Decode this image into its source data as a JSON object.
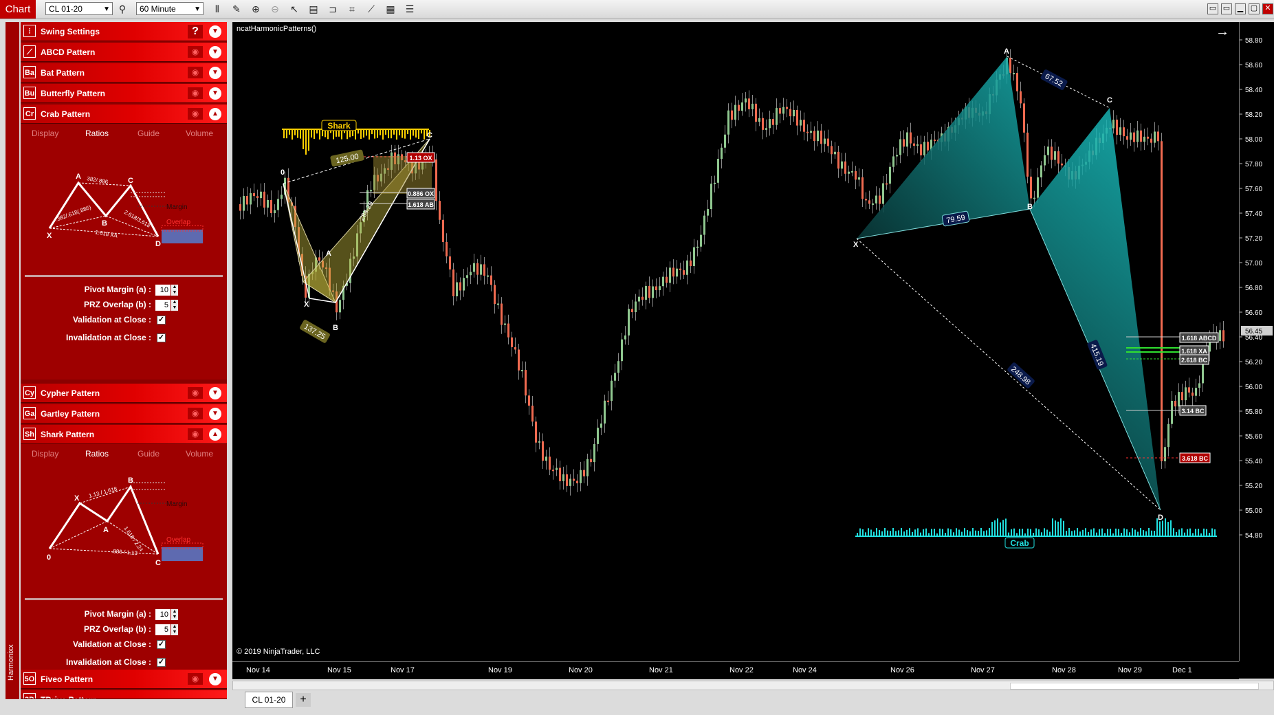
{
  "toolbar": {
    "chart_tab": "Chart",
    "instrument": "CL 01-20",
    "interval": "60 Minute"
  },
  "sidebar_vertical_label": "Harmonixx",
  "panels": [
    {
      "icon": "⫶",
      "label": "Swing Settings"
    },
    {
      "icon": "⟋",
      "label": "ABCD Pattern"
    },
    {
      "icon": "Ba",
      "label": "Bat Pattern"
    },
    {
      "icon": "Bu",
      "label": "Butterfly Pattern"
    },
    {
      "icon": "Cr",
      "label": "Crab Pattern"
    },
    {
      "icon": "Cy",
      "label": "Cypher Pattern"
    },
    {
      "icon": "Ga",
      "label": "Gartley Pattern"
    },
    {
      "icon": "Sh",
      "label": "Shark Pattern"
    },
    {
      "icon": "5O",
      "label": "Fiveo Pattern"
    },
    {
      "icon": "3D",
      "label": "TDrive Pattern"
    }
  ],
  "panel_tabs": [
    "Display",
    "Ratios",
    "Guide",
    "Volume"
  ],
  "crab_diagram": {
    "points": [
      "X",
      "A",
      "B",
      "C",
      "D"
    ],
    "labels": {
      "xa": "382/.886",
      "xb": ".382/.618(.886)",
      "bc": "2.618/3.618",
      "xd": "1.618 XA",
      "margin": "Margin",
      "overlap": "Overlap"
    }
  },
  "shark_diagram": {
    "points": [
      "0",
      "X",
      "A",
      "B",
      "C"
    ],
    "labels": {
      "xb": "1.13 / 1.618",
      "ac": "1.618 / 2.24",
      "oc": ".886 / 1.13",
      "margin": "Margin",
      "overlap": "Overlap"
    }
  },
  "params": {
    "pivot_margin_label": "Pivot Margin (a) :",
    "pivot_margin_value": "10",
    "prz_overlap_label": "PRZ Overlap (b) :",
    "prz_overlap_value": "5",
    "validation_label": "Validation at Close :",
    "invalidation_label": "Invalidation at Close :"
  },
  "chart": {
    "title": "ncatHarmonicPatterns()",
    "copyright": "© 2019 NinjaTrader, LLC",
    "price_ticks": [
      "58.80",
      "58.60",
      "58.40",
      "58.20",
      "58.00",
      "57.80",
      "57.60",
      "57.40",
      "57.20",
      "57.00",
      "56.80",
      "56.60",
      "56.40",
      "56.20",
      "56.00",
      "55.80",
      "55.60",
      "55.40",
      "55.20",
      "55.00",
      "54.80"
    ],
    "current_price": "56.45",
    "date_ticks": [
      "Nov 14",
      "Nov 15",
      "Nov 17",
      "Nov 19",
      "Nov 20",
      "Nov 21",
      "Nov 22",
      "Nov 24",
      "Nov 26",
      "Nov 27",
      "Nov 28",
      "Nov 29",
      "Dec 1"
    ],
    "shark_pattern": {
      "name": "Shark",
      "points": [
        "0",
        "X",
        "A",
        "B",
        "C"
      ],
      "legs": {
        "ox": "125.00",
        "xa": "137.25",
        "ab": "284.29"
      },
      "levels": [
        "1.13 OX",
        "0.886 OX",
        "1.618 AB"
      ]
    },
    "crab_pattern": {
      "name": "Crab",
      "points": [
        "X",
        "A",
        "B",
        "C",
        "D"
      ],
      "legs": {
        "xb": "79.59",
        "ac": "67.52",
        "xd": "248.98",
        "bd": "415.19"
      },
      "levels": [
        "1.618 ABCD",
        "1.618 XA",
        "2.618 BC",
        "3.14 BC",
        "3.618 BC"
      ]
    }
  },
  "bottom_tab": "CL 01-20"
}
